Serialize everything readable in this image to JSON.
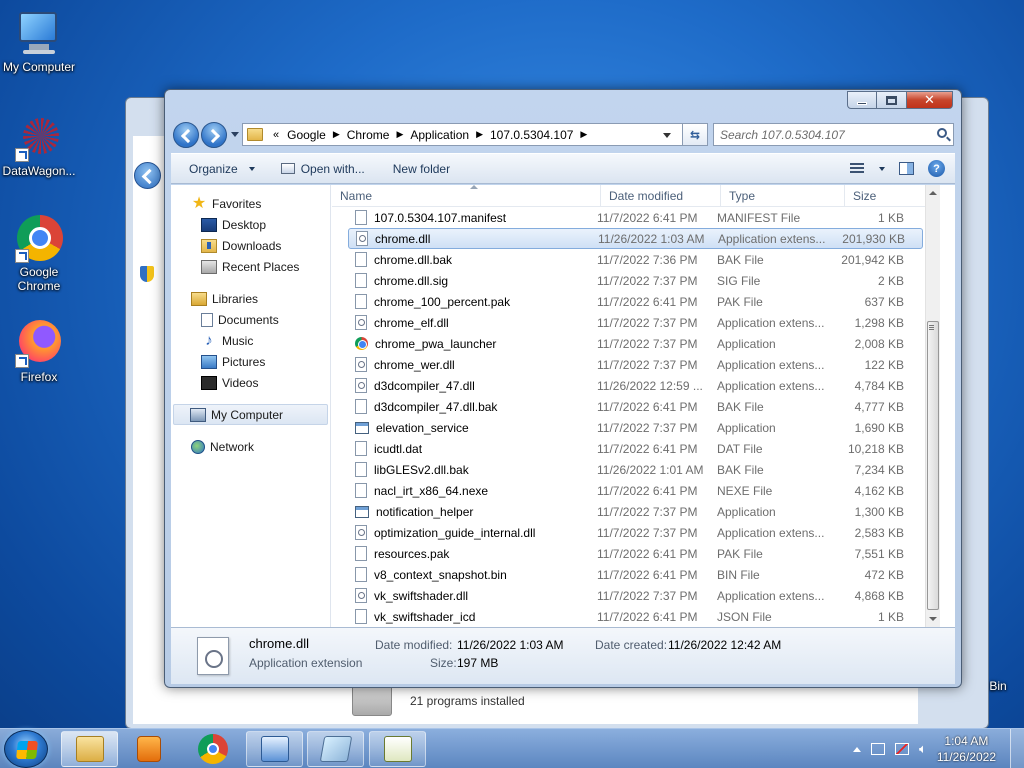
{
  "desktop": {
    "icons": [
      {
        "label": "My Computer",
        "icon": "computer-icon"
      },
      {
        "label": "DataWagon...",
        "icon": "datawagon-icon"
      },
      {
        "label": "Google Chrome",
        "icon": "chrome-icon"
      },
      {
        "label": "Firefox",
        "icon": "firefox-icon"
      },
      {
        "label": "Recycle Bin",
        "icon": "recycle-bin-icon"
      }
    ]
  },
  "background_window": {
    "programs_text": "21 programs installed"
  },
  "explorer": {
    "address": {
      "prefix": "«",
      "segments": [
        "Google",
        "Chrome",
        "Application",
        "107.0.5304.107"
      ]
    },
    "search_placeholder": "Search 107.0.5304.107",
    "toolbar": {
      "organize": "Organize",
      "open_with": "Open with...",
      "new_folder": "New folder"
    },
    "nav": {
      "favorites": "Favorites",
      "desktop": "Desktop",
      "downloads": "Downloads",
      "recent_places": "Recent Places",
      "libraries": "Libraries",
      "documents": "Documents",
      "music": "Music",
      "pictures": "Pictures",
      "videos": "Videos",
      "my_computer": "My Computer",
      "network": "Network"
    },
    "columns": {
      "name": "Name",
      "date": "Date modified",
      "type": "Type",
      "size": "Size"
    },
    "files": [
      {
        "name": "107.0.5304.107.manifest",
        "date": "11/7/2022 6:41 PM",
        "type": "MANIFEST File",
        "size": "1 KB",
        "icon": "file"
      },
      {
        "name": "chrome.dll",
        "date": "11/26/2022 1:03 AM",
        "type": "Application extens...",
        "size": "201,930 KB",
        "icon": "dll"
      },
      {
        "name": "chrome.dll.bak",
        "date": "11/7/2022 7:36 PM",
        "type": "BAK File",
        "size": "201,942 KB",
        "icon": "file"
      },
      {
        "name": "chrome.dll.sig",
        "date": "11/7/2022 7:37 PM",
        "type": "SIG File",
        "size": "2 KB",
        "icon": "file"
      },
      {
        "name": "chrome_100_percent.pak",
        "date": "11/7/2022 6:41 PM",
        "type": "PAK File",
        "size": "637 KB",
        "icon": "file"
      },
      {
        "name": "chrome_elf.dll",
        "date": "11/7/2022 7:37 PM",
        "type": "Application extens...",
        "size": "1,298 KB",
        "icon": "dll"
      },
      {
        "name": "chrome_pwa_launcher",
        "date": "11/7/2022 7:37 PM",
        "type": "Application",
        "size": "2,008 KB",
        "icon": "chrome"
      },
      {
        "name": "chrome_wer.dll",
        "date": "11/7/2022 7:37 PM",
        "type": "Application extens...",
        "size": "122 KB",
        "icon": "dll"
      },
      {
        "name": "d3dcompiler_47.dll",
        "date": "11/26/2022 12:59 ...",
        "type": "Application extens...",
        "size": "4,784 KB",
        "icon": "dll"
      },
      {
        "name": "d3dcompiler_47.dll.bak",
        "date": "11/7/2022 6:41 PM",
        "type": "BAK File",
        "size": "4,777 KB",
        "icon": "file"
      },
      {
        "name": "elevation_service",
        "date": "11/7/2022 7:37 PM",
        "type": "Application",
        "size": "1,690 KB",
        "icon": "exe"
      },
      {
        "name": "icudtl.dat",
        "date": "11/7/2022 6:41 PM",
        "type": "DAT File",
        "size": "10,218 KB",
        "icon": "file"
      },
      {
        "name": "libGLESv2.dll.bak",
        "date": "11/26/2022 1:01 AM",
        "type": "BAK File",
        "size": "7,234 KB",
        "icon": "file"
      },
      {
        "name": "nacl_irt_x86_64.nexe",
        "date": "11/7/2022 6:41 PM",
        "type": "NEXE File",
        "size": "4,162 KB",
        "icon": "file"
      },
      {
        "name": "notification_helper",
        "date": "11/7/2022 7:37 PM",
        "type": "Application",
        "size": "1,300 KB",
        "icon": "exe"
      },
      {
        "name": "optimization_guide_internal.dll",
        "date": "11/7/2022 7:37 PM",
        "type": "Application extens...",
        "size": "2,583 KB",
        "icon": "dll"
      },
      {
        "name": "resources.pak",
        "date": "11/7/2022 6:41 PM",
        "type": "PAK File",
        "size": "7,551 KB",
        "icon": "file"
      },
      {
        "name": "v8_context_snapshot.bin",
        "date": "11/7/2022 6:41 PM",
        "type": "BIN File",
        "size": "472 KB",
        "icon": "file"
      },
      {
        "name": "vk_swiftshader.dll",
        "date": "11/7/2022 7:37 PM",
        "type": "Application extens...",
        "size": "4,868 KB",
        "icon": "dll"
      },
      {
        "name": "vk_swiftshader_icd",
        "date": "11/7/2022 6:41 PM",
        "type": "JSON File",
        "size": "1 KB",
        "icon": "file"
      }
    ],
    "selected_index": 1,
    "details": {
      "name": "chrome.dll",
      "type": "Application extension",
      "modified_label": "Date modified:",
      "modified_value": "11/26/2022 1:03 AM",
      "created_label": "Date created:",
      "created_value": "11/26/2022 12:42 AM",
      "size_label": "Size:",
      "size_value": "197 MB"
    }
  },
  "taskbar": {
    "time": "1:04 AM",
    "date": "11/26/2022"
  }
}
